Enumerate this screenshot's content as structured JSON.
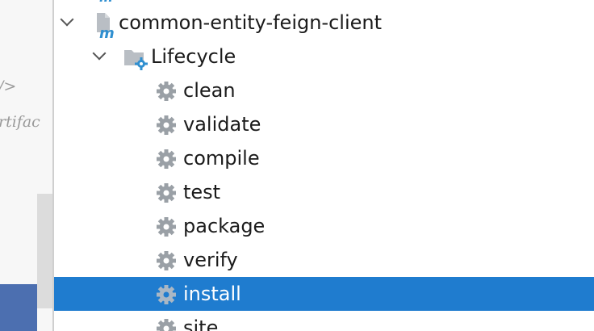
{
  "editor": {
    "line1": "/>",
    "line2": "rtifac"
  },
  "tree": {
    "project": {
      "label": "common-entity-feign-client",
      "icon": "maven-module-icon",
      "expanded": true
    },
    "lifecycle": {
      "label": "Lifecycle",
      "icon": "lifecycle-folder-icon",
      "expanded": true
    },
    "goals": [
      {
        "label": "clean",
        "icon": "gear-icon"
      },
      {
        "label": "validate",
        "icon": "gear-icon"
      },
      {
        "label": "compile",
        "icon": "gear-icon"
      },
      {
        "label": "test",
        "icon": "gear-icon"
      },
      {
        "label": "package",
        "icon": "gear-icon"
      },
      {
        "label": "verify",
        "icon": "gear-icon"
      },
      {
        "label": "install",
        "icon": "gear-icon",
        "selected": true
      },
      {
        "label": "site",
        "icon": "gear-icon"
      }
    ]
  },
  "colors": {
    "selection": "#1f7ccf",
    "maven_blue": "#2f8fd0",
    "gear": "#9aa0a6"
  }
}
